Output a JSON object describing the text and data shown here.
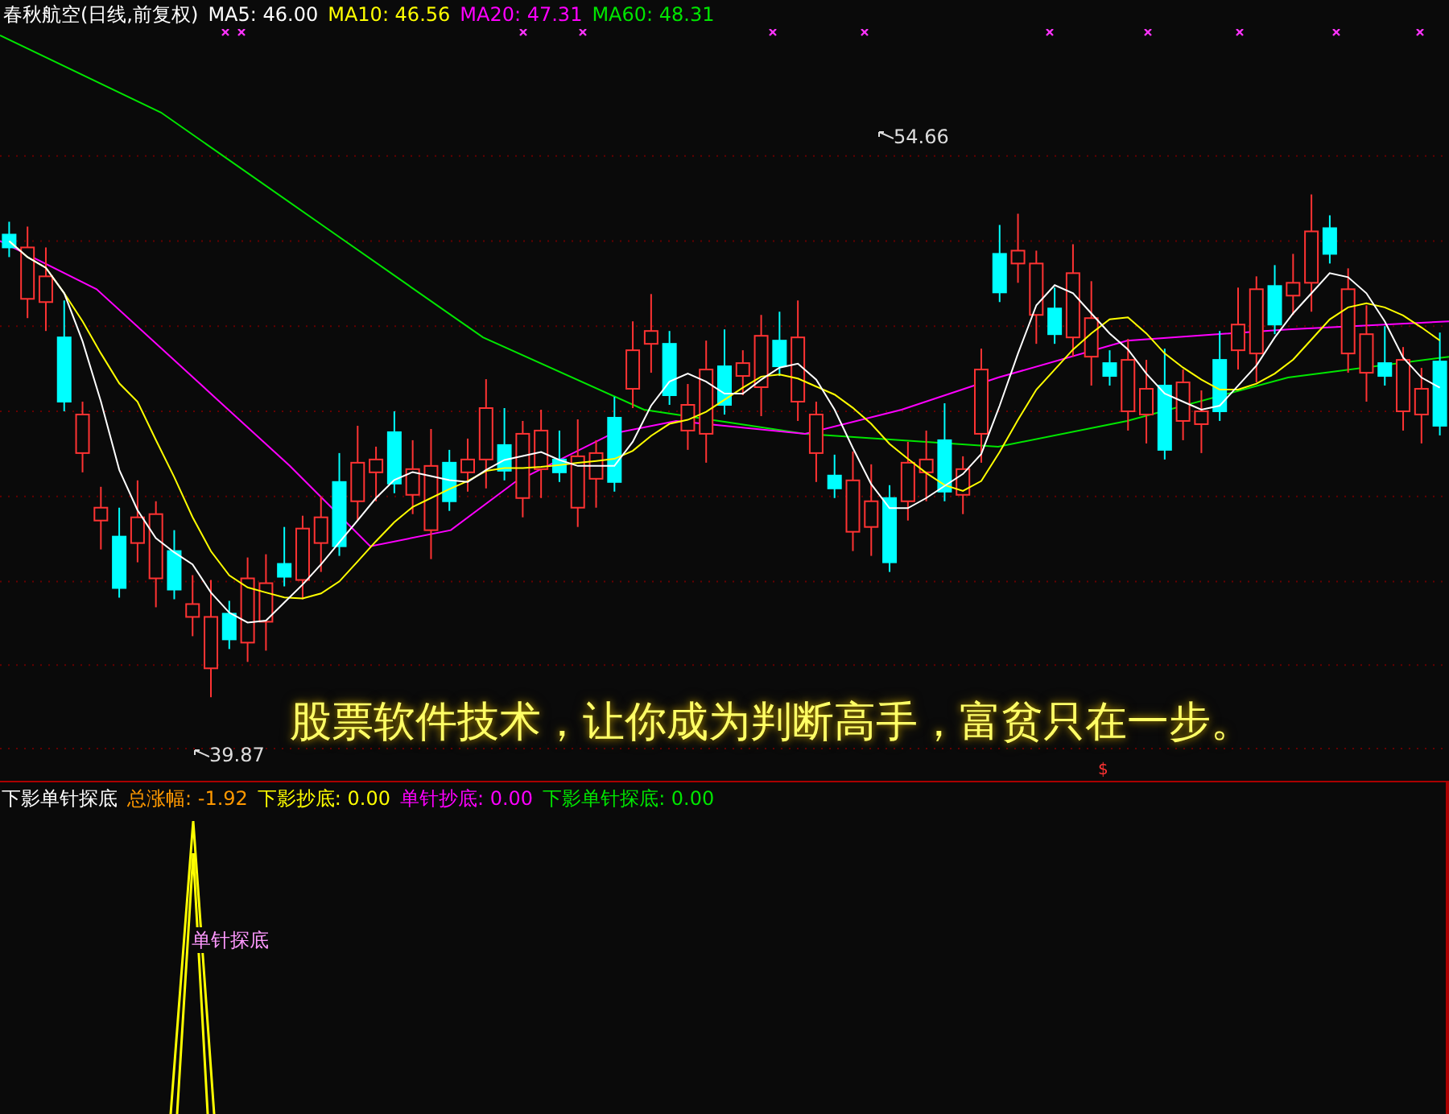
{
  "chart_header": {
    "title": "春秋航空(日线,前复权)",
    "indicators": [
      {
        "label": "MA5: 46.00",
        "color": "#ffffff"
      },
      {
        "label": "MA10: 46.56",
        "color": "#ffff00"
      },
      {
        "label": "MA20: 47.31",
        "color": "#ff00ff"
      },
      {
        "label": "MA60: 48.31",
        "color": "#00e600"
      }
    ]
  },
  "price_labels": [
    {
      "kind": "high",
      "text": "54.66"
    },
    {
      "kind": "low",
      "text": "39.87"
    }
  ],
  "caption": "股票软件技术，让你成为判断高手，富贫只在一步。",
  "signal_mark": "$",
  "indicator_panel": {
    "title": "下影单针探底",
    "values": [
      {
        "label": "总涨幅: -1.92",
        "color": "#ff9900"
      },
      {
        "label": "下影抄底: 0.00",
        "color": "#ffff00"
      },
      {
        "label": "单针抄底: 0.00",
        "color": "#ff00ff"
      },
      {
        "label": "下影单针探底: 0.00",
        "color": "#00e600"
      }
    ],
    "signal_label": "单针探底"
  }
}
